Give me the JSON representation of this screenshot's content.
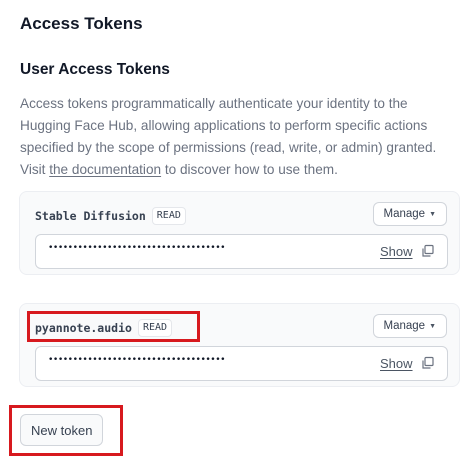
{
  "page": {
    "title": "Access Tokens"
  },
  "section": {
    "title": "User Access Tokens",
    "description_before_link": "Access tokens programmatically authenticate your identity to the Hugging Face Hub, allowing applications to perform specific actions specified by the scope of permissions (read, write, or admin) granted. Visit ",
    "link_text": "the documentation",
    "description_after_link": " to discover how to use them."
  },
  "tokens": [
    {
      "name": "Stable Diffusion",
      "role": "READ",
      "manage_label": "Manage",
      "masked_value": "••••••••••••••••••••••••••••••••••••",
      "show_label": "Show"
    },
    {
      "name": "pyannote.audio",
      "role": "READ",
      "manage_label": "Manage",
      "masked_value": "••••••••••••••••••••••••••••••••••••",
      "show_label": "Show"
    }
  ],
  "new_token_label": "New token",
  "highlight_color": "#d7191e"
}
